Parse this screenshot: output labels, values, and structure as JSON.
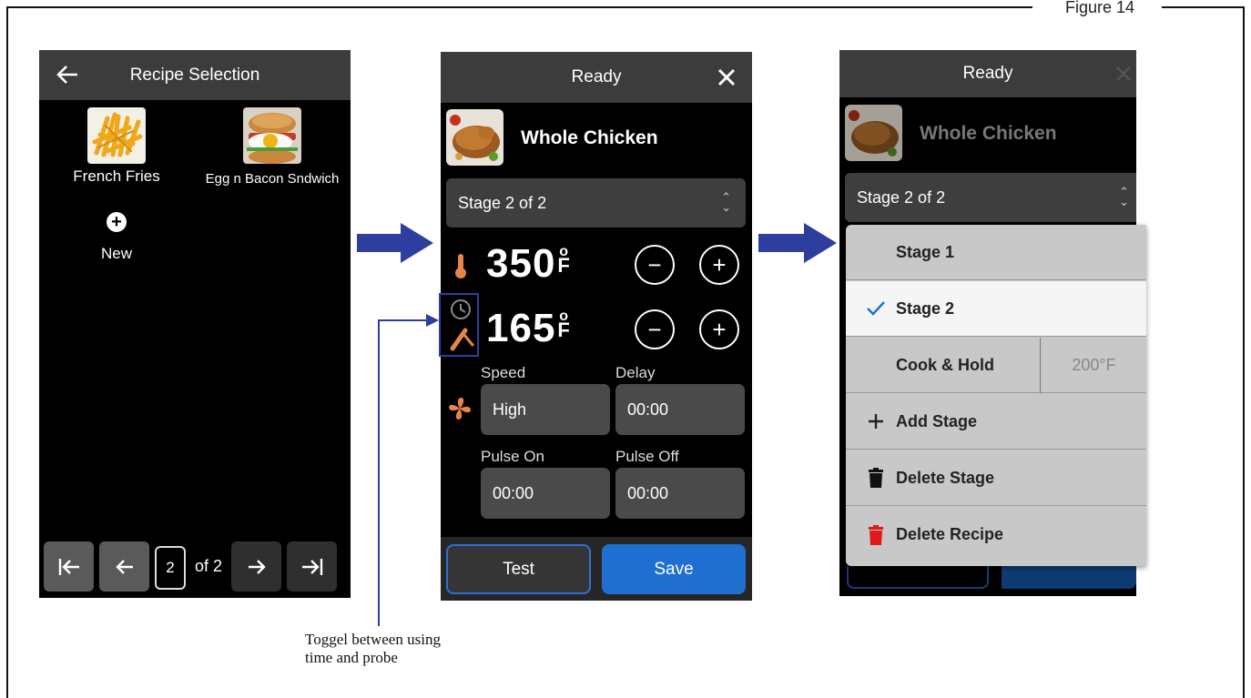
{
  "figure_label": "Figure 14",
  "screen1": {
    "title": "Recipe Selection",
    "recipes": [
      {
        "name": "French Fries"
      },
      {
        "name": "Egg n Bacon Sndwich"
      }
    ],
    "new_label": "New",
    "pager": {
      "page": "2",
      "of": "of 2"
    }
  },
  "screen2": {
    "title": "Ready",
    "recipe_name": "Whole Chicken",
    "stage": "Stage 2 of 2",
    "temp_value": "350",
    "probe_value": "165",
    "unit_deg": "o",
    "unit_f": "F",
    "speed_label": "Speed",
    "speed_value": "High",
    "delay_label": "Delay",
    "delay_value": "00:00",
    "pulse_on_label": "Pulse On",
    "pulse_on_value": "00:00",
    "pulse_off_label": "Pulse Off",
    "pulse_off_value": "00:00",
    "test_label": "Test",
    "save_label": "Save"
  },
  "screen3": {
    "title": "Ready",
    "recipe_name": "Whole Chicken",
    "stage": "Stage 2 of 2",
    "menu": {
      "stage1": "Stage 1",
      "stage2": "Stage 2",
      "cook_hold": "Cook & Hold",
      "cook_hold_temp": "200°F",
      "add_stage": "Add Stage",
      "delete_stage": "Delete Stage",
      "delete_recipe": "Delete Recipe"
    }
  },
  "callout": {
    "line1": "Toggel between using",
    "line2": "time and probe"
  },
  "colors": {
    "accent_blue": "#1f6fd1",
    "arrow_blue": "#2d3e9e",
    "delete_red": "#e01818",
    "icon_orange": "#e8844a"
  }
}
